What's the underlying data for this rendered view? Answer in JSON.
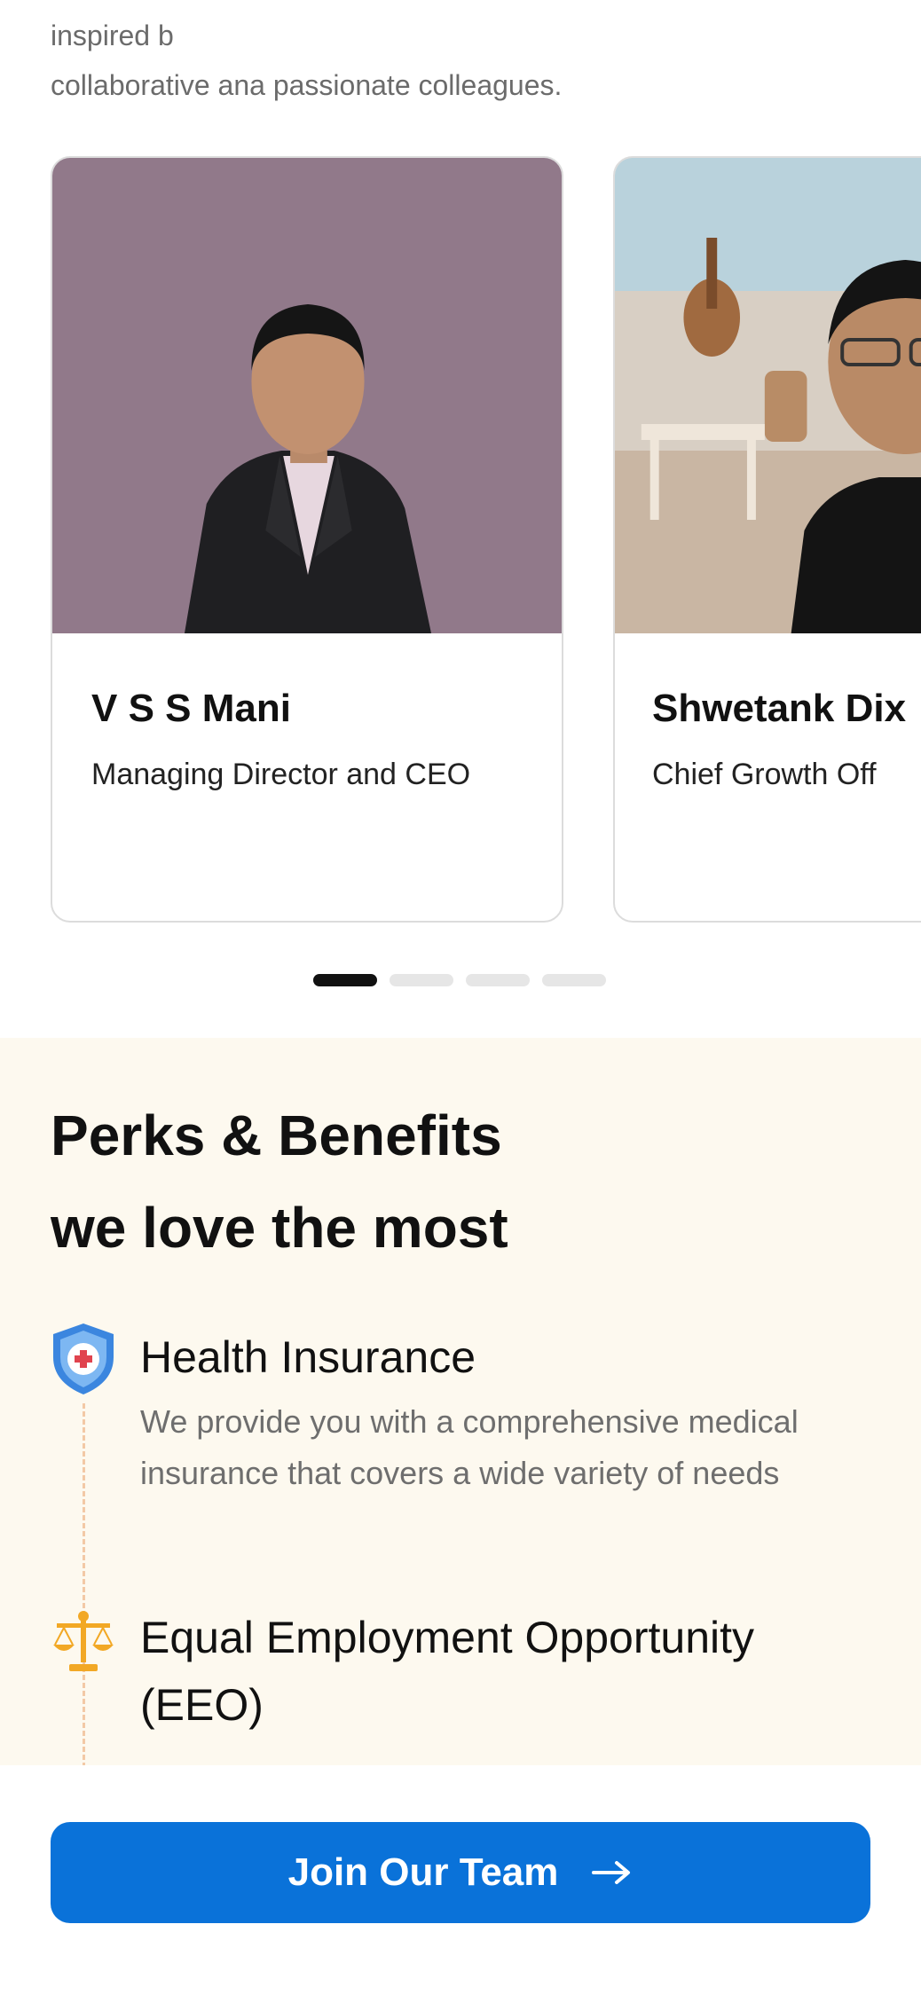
{
  "intro": {
    "line1": "inspired b",
    "line2": "collaborative ana passionate colleagues."
  },
  "team": [
    {
      "name": "V S S Mani",
      "role": "Managing Director and CEO"
    },
    {
      "name": "Shwetank Dix",
      "role": "Chief Growth Off"
    }
  ],
  "carousel": {
    "page_count": 4,
    "active_index": 0
  },
  "perks": {
    "heading_line1": "Perks & Benefits",
    "heading_line2": "we love the most",
    "items": [
      {
        "icon": "shield-medical-icon",
        "title": "Health Insurance",
        "description": "We provide you with a comprehensive medical insurance that covers a wide variety of needs"
      },
      {
        "icon": "scales-icon",
        "title_line1": "Equal Employment Opportunity",
        "title_line2": "(EEO)"
      }
    ]
  },
  "cta": {
    "label": "Join Our Team",
    "icon": "arrow-right-icon"
  },
  "colors": {
    "cta_blue": "#0a72d9",
    "perks_bg": "#fdf9ef",
    "timeline": "#f3c9a6"
  }
}
